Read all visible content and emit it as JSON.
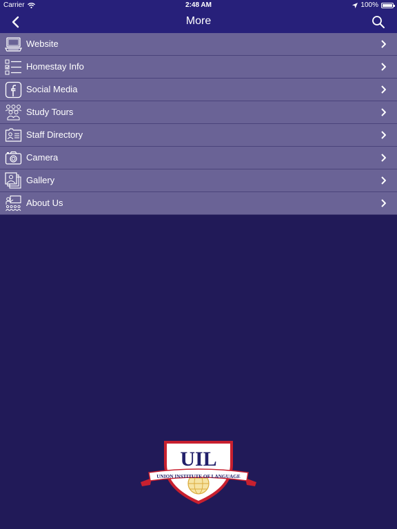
{
  "status_bar": {
    "carrier": "Carrier",
    "time": "2:48 AM",
    "battery": "100%"
  },
  "nav": {
    "title": "More",
    "back_icon": "chevron-left-icon",
    "search_icon": "search-icon"
  },
  "menu": {
    "items": [
      {
        "label": "Website",
        "icon": "computer-icon"
      },
      {
        "label": "Homestay Info",
        "icon": "list-icon"
      },
      {
        "label": "Social Media",
        "icon": "facebook-icon"
      },
      {
        "label": "Study Tours",
        "icon": "group-icon"
      },
      {
        "label": "Staff Directory",
        "icon": "id-card-icon"
      },
      {
        "label": "Camera",
        "icon": "camera-icon"
      },
      {
        "label": "Gallery",
        "icon": "photos-icon"
      },
      {
        "label": "About Us",
        "icon": "presentation-icon"
      }
    ]
  },
  "logo": {
    "initials": "UIL",
    "banner": "UNION INSTITUTE OF LANGUAGE"
  },
  "colors": {
    "background": "#211a58",
    "bar": "#27207a",
    "row": "#6a6396",
    "logo_red": "#c8202f"
  }
}
